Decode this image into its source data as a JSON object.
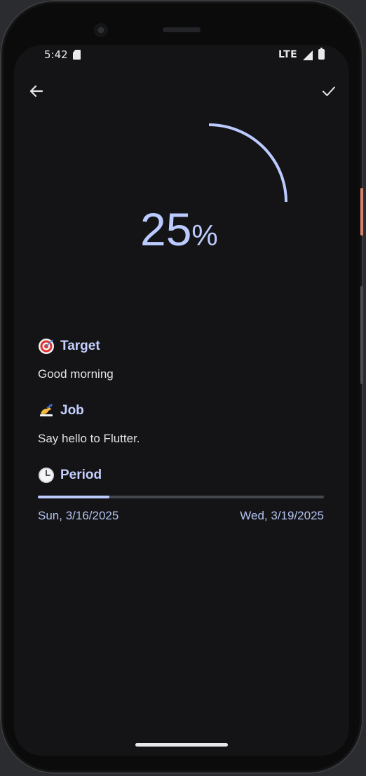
{
  "status_bar": {
    "time": "5:42",
    "network": "LTE"
  },
  "app_bar": {
    "back_icon": "arrow-left-icon",
    "confirm_icon": "check-icon"
  },
  "progress": {
    "percent_value": "25",
    "percent_sign": "%",
    "fraction": 0.25
  },
  "sections": {
    "target": {
      "emoji": "direct-hit-icon",
      "title": "Target",
      "text": "Good morning"
    },
    "job": {
      "emoji": "writing-hand-icon",
      "title": "Job",
      "text": "Say hello to Flutter."
    },
    "period": {
      "emoji": "clock-icon",
      "title": "Period",
      "start": "Sun, 3/16/2025",
      "end": "Wed, 3/19/2025",
      "elapsed_fraction": 0.25
    }
  },
  "colors": {
    "accent": "#bccbff",
    "background": "#141416",
    "track": "#45474f"
  }
}
